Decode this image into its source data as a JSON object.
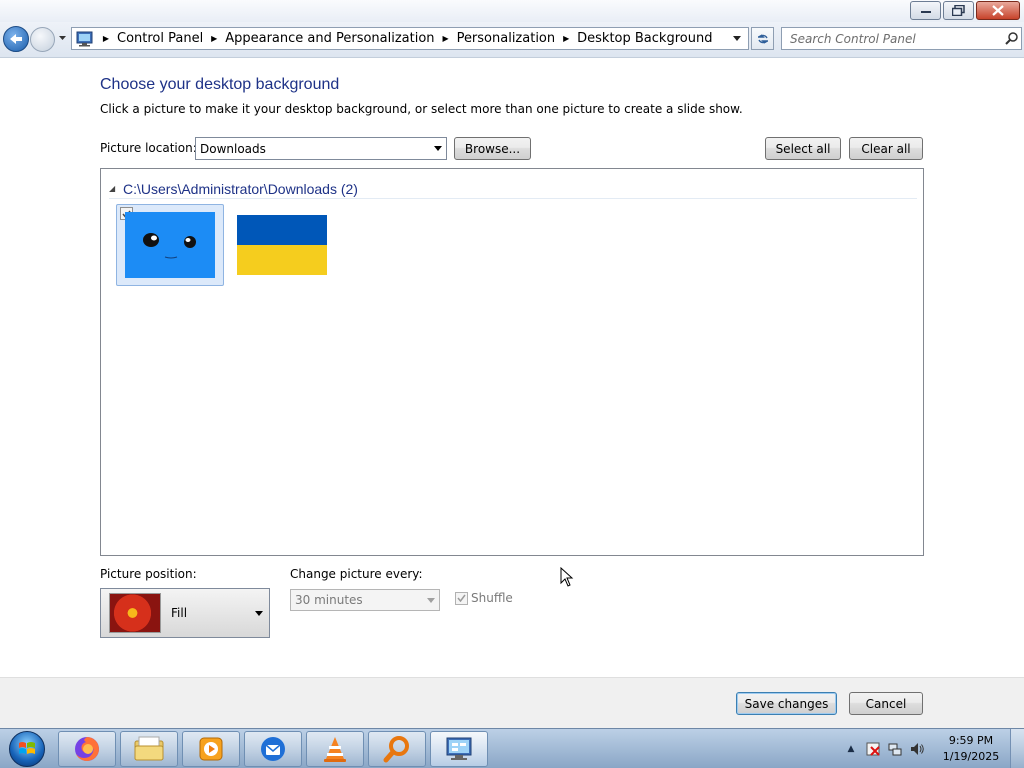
{
  "window": {
    "buttons": [
      "minimize",
      "maximize",
      "close"
    ]
  },
  "address": {
    "crumbs": [
      "Control Panel",
      "Appearance and Personalization",
      "Personalization",
      "Desktop Background"
    ],
    "search_placeholder": "Search Control Panel"
  },
  "page": {
    "heading": "Choose your desktop background",
    "subtext": "Click a picture to make it your desktop background, or select more than one picture to create a slide show.",
    "location_label": "Picture location:",
    "location_value": "Downloads",
    "browse_label": "Browse...",
    "select_all_label": "Select all",
    "clear_all_label": "Clear all"
  },
  "gallery": {
    "group_title": "C:\\Users\\Administrator\\Downloads (2)",
    "items": [
      {
        "name": "blue-face-image",
        "selected": true,
        "checked": true,
        "color": "#1c8cf5"
      },
      {
        "name": "ukraine-flag-image",
        "selected": false,
        "checked": false,
        "colors": [
          "#0057b8",
          "#f5cd1e"
        ]
      }
    ]
  },
  "options": {
    "position_label": "Picture position:",
    "position_value": "Fill",
    "change_label": "Change picture every:",
    "change_value": "30 minutes",
    "shuffle_label": "Shuffle",
    "shuffle_checked": true
  },
  "footer": {
    "save_label": "Save changes",
    "cancel_label": "Cancel"
  },
  "taskbar": {
    "apps": [
      "firefox-icon",
      "file-explorer-icon",
      "media-player-icon",
      "thunderbird-icon",
      "vlc-icon",
      "search-magnifier-icon",
      "control-panel-icon"
    ],
    "time": "9:59 PM",
    "date": "1/19/2025"
  },
  "colors": {
    "heading": "#1e3287",
    "accent": "#3c7fb1"
  }
}
